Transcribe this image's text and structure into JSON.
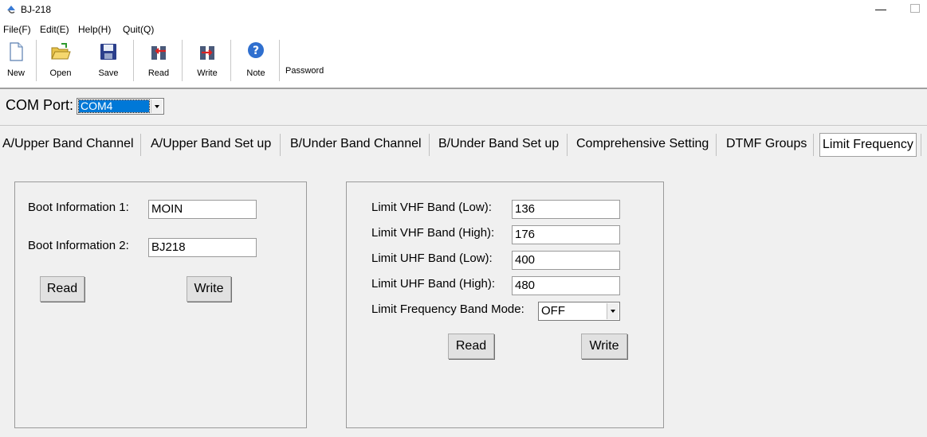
{
  "window": {
    "title": "BJ-218"
  },
  "menu": {
    "items": [
      "File(F)",
      "Edit(E)",
      "Help(H)",
      "Quit(Q)"
    ]
  },
  "toolbar": {
    "new_label": "New",
    "open_label": "Open",
    "save_label": "Save",
    "read_label": "Read",
    "write_label": "Write",
    "note_label": "Note",
    "password_label": "Password"
  },
  "com": {
    "label": "COM Port:",
    "value": "COM4"
  },
  "tabs": [
    "A/Upper Band Channel",
    "A/Upper Band Set up",
    "B/Under Band Channel",
    "B/Under Band Set up",
    "Comprehensive Setting",
    "DTMF Groups",
    "Limit Frequency"
  ],
  "active_tab": "Limit Frequency",
  "boot": {
    "info1_label": "Boot Information 1:",
    "info1_value": "MOIN",
    "info2_label": "Boot Information 2:",
    "info2_value": "BJ218",
    "read_label": "Read",
    "write_label": "Write"
  },
  "limits": {
    "vhf_low_label": "Limit VHF Band (Low):",
    "vhf_low_value": "136",
    "vhf_high_label": "Limit VHF Band (High):",
    "vhf_high_value": "176",
    "uhf_low_label": "Limit UHF Band (Low):",
    "uhf_low_value": "400",
    "uhf_high_label": "Limit UHF Band (High):",
    "uhf_high_value": "480",
    "mode_label": "Limit Frequency Band Mode:",
    "mode_value": "OFF",
    "read_label": "Read",
    "write_label": "Write"
  },
  "colors": {
    "selection": "#0078d7",
    "background": "#f0f0f0"
  }
}
